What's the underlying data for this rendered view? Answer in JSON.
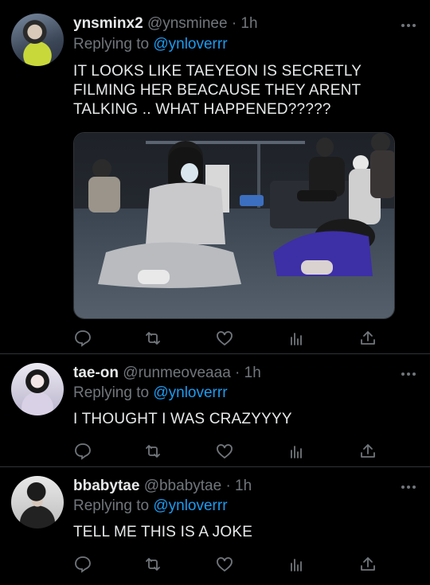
{
  "tweets": [
    {
      "display_name": "ynsminx2",
      "handle": "@ynsminee",
      "time": "· 1h",
      "replying_prefix": "Replying to",
      "replying_to": "@ynloverrr",
      "text": "IT LOOKS LIKE TAEYEON IS SECRETLY FILMING HER BEACAUSE THEY ARENT TALKING .. WHAT HAPPENED?????"
    },
    {
      "display_name": "tae-on",
      "handle": "@runmeoveaaa",
      "time": "· 1h",
      "replying_prefix": "Replying to",
      "replying_to": "@ynloverrr",
      "text": "I THOUGHT I WAS CRAZYYYY"
    },
    {
      "display_name": "bbabytae",
      "handle": "@bbabytae",
      "time": "· 1h",
      "replying_prefix": "Replying to",
      "replying_to": "@ynloverrr",
      "text": "TELL ME THIS IS A JOKE"
    }
  ],
  "icons": [
    "reply-icon",
    "retweet-icon",
    "like-icon",
    "analytics-icon",
    "share-icon",
    "more-icon"
  ],
  "colors": {
    "background": "#000000",
    "text": "#e7e9ea",
    "muted": "#71767b",
    "link": "#1d9bf0",
    "divider": "#2f3336"
  }
}
